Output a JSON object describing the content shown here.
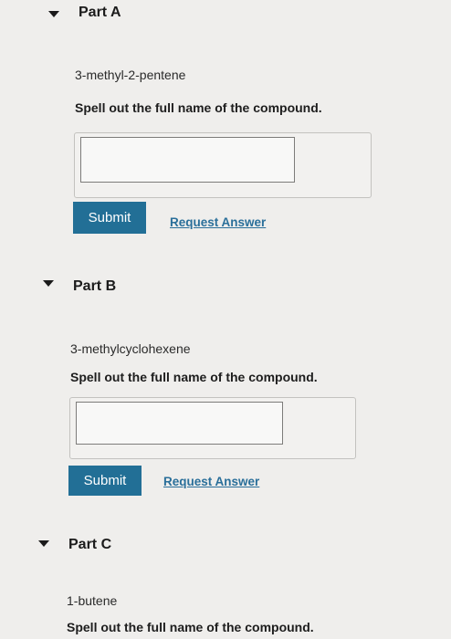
{
  "parts": [
    {
      "title": "Part A",
      "compound": "3-methyl-2-pentene",
      "prompt": "Spell out the full name of the compound.",
      "answer_value": "",
      "submit_label": "Submit",
      "request_label": "Request Answer"
    },
    {
      "title": "Part B",
      "compound": "3-methylcyclohexene",
      "prompt": "Spell out the full name of the compound.",
      "answer_value": "",
      "submit_label": "Submit",
      "request_label": "Request Answer"
    },
    {
      "title": "Part C",
      "compound": "1-butene",
      "prompt": "Spell out the full name of the compound."
    }
  ],
  "icons": {
    "toggle": "caret-down-icon"
  },
  "colors": {
    "submit_bg": "#226f96",
    "link": "#2a6f9a"
  }
}
